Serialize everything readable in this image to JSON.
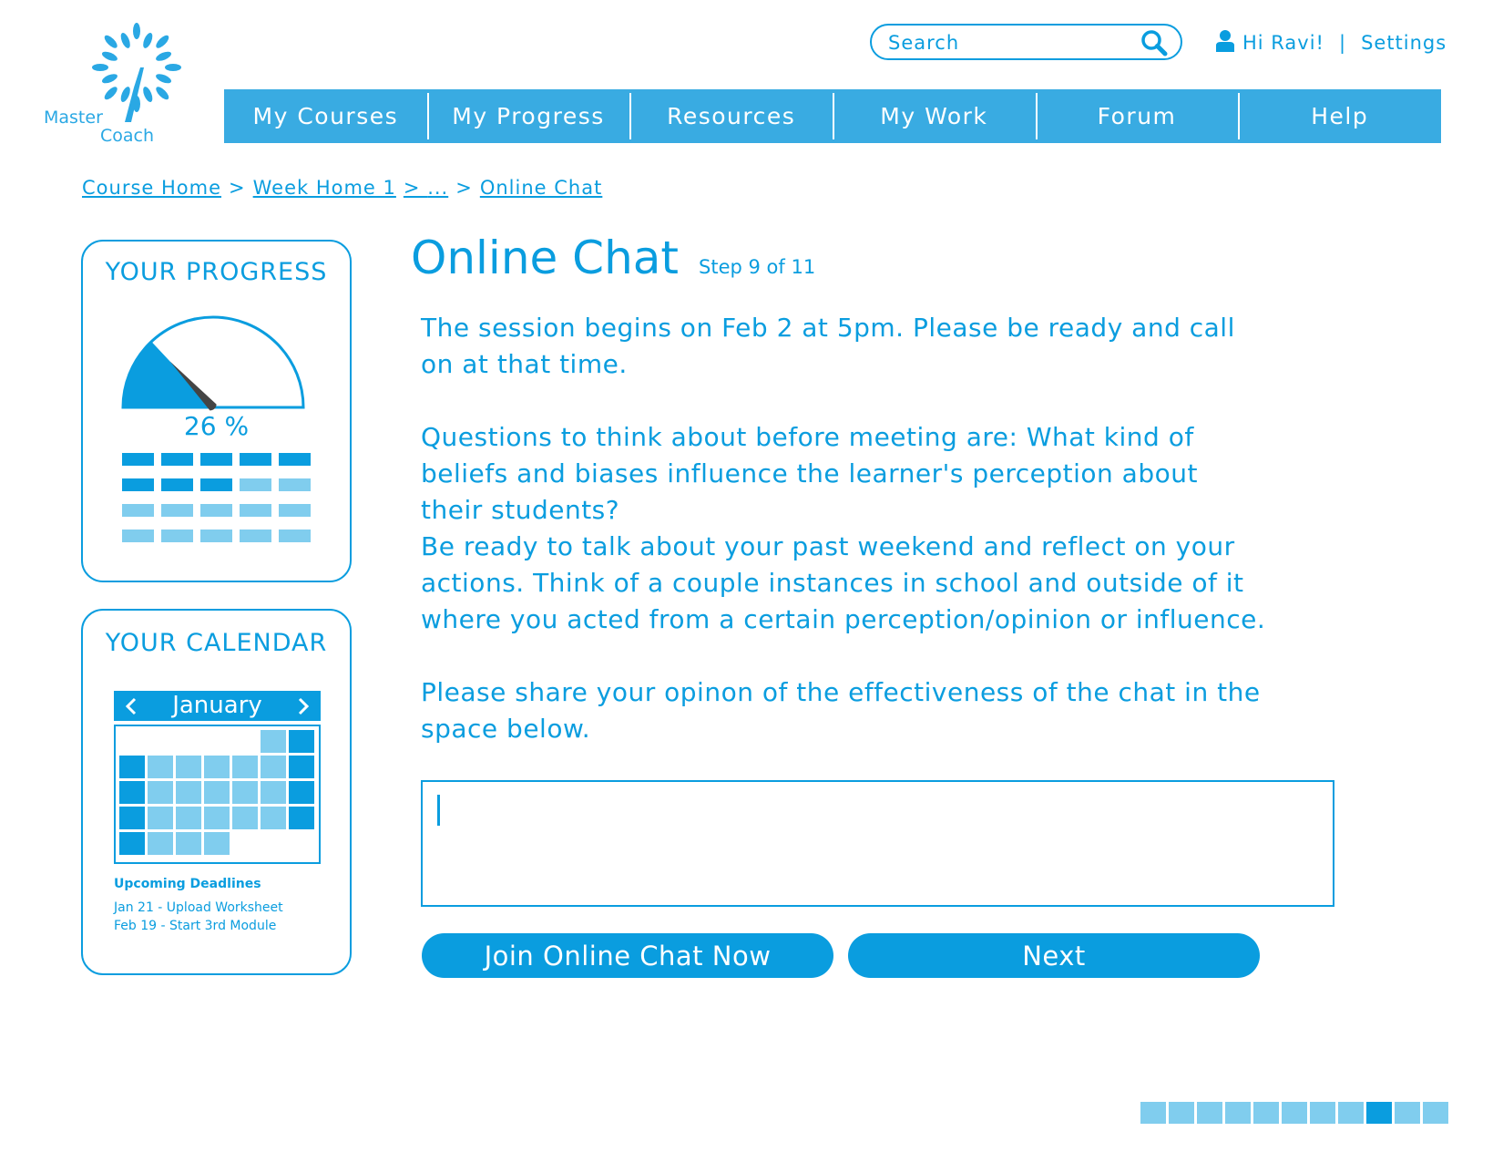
{
  "brand": {
    "logo_line1": "Master",
    "logo_line2": "Coach",
    "logo_icon": "sunburst-1-icon"
  },
  "search": {
    "placeholder": "Search",
    "icon": "search-icon"
  },
  "user": {
    "icon": "person-icon",
    "greeting": "Hi Ravi!",
    "separator": "|",
    "settings": "Settings"
  },
  "nav": {
    "items": [
      {
        "label": "My Courses"
      },
      {
        "label": "My Progress"
      },
      {
        "label": "Resources"
      },
      {
        "label": "My Work"
      },
      {
        "label": "Forum"
      },
      {
        "label": "Help"
      }
    ]
  },
  "breadcrumb": {
    "items": [
      "Course Home",
      "Week Home 1",
      "...",
      "Online Chat"
    ],
    "separator": ">"
  },
  "progress": {
    "title": "YOUR PROGRESS",
    "percent_label": "26 %",
    "percent": 0.26,
    "grid_filled": [
      1,
      1,
      1,
      1,
      1,
      1,
      1,
      1,
      0,
      0,
      0,
      0,
      0,
      0,
      0,
      0,
      0,
      0,
      0,
      0
    ]
  },
  "calendar": {
    "title": "YOUR CALENDAR",
    "month": "January",
    "prev_icon": "chevron-left-icon",
    "next_icon": "chevron-right-icon",
    "cells": [
      "none",
      "none",
      "none",
      "none",
      "none",
      "light",
      "dark",
      "dark",
      "light",
      "light",
      "light",
      "light",
      "light",
      "dark",
      "dark",
      "light",
      "light",
      "light",
      "light",
      "light",
      "dark",
      "dark",
      "light",
      "light",
      "light",
      "light",
      "light",
      "dark",
      "dark",
      "light",
      "light",
      "light",
      "none",
      "none",
      "none"
    ],
    "deadlines_title": "Upcoming Deadlines",
    "deadlines": [
      "Jan 21 - Upload Worksheet",
      "Feb 19 - Start 3rd Module"
    ]
  },
  "main": {
    "title": "Online Chat",
    "step": "Step 9 of 11",
    "paragraphs": [
      "The session begins on Feb 2 at 5pm. Please be ready and call on at that time.",
      "Questions to think about before meeting are: What kind of beliefs and biases influence the learner's perception about their students?",
      "Be ready to talk about your past weekend and reflect on your actions. Think of a couple instances in school and outside of it where you acted from a certain perception/opinion or influence.",
      "Please share your opinon of the effectiveness of the chat in the space below."
    ],
    "response_value": "",
    "join_button": "Join Online Chat Now",
    "next_button": "Next"
  },
  "step_progress": {
    "total": 11,
    "current": 9
  },
  "colors": {
    "primary": "#0a9ddf",
    "nav": "#39abe2",
    "light": "#80cdee",
    "gauge_needle": "#444444"
  }
}
